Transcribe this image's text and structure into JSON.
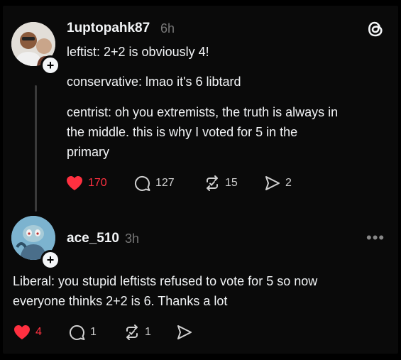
{
  "post": {
    "username": "1uptopahk87",
    "time": "6h",
    "lines": [
      "leftist: 2+2 is obviously 4!",
      "conservative: lmao it's 6 libtard",
      "centrist: oh you extremists, the truth is always in",
      "the middle. this is why I voted for 5 in the",
      "primary"
    ],
    "likes": "170",
    "comments": "127",
    "reposts": "15",
    "shares": "2"
  },
  "reply": {
    "username": "ace_510",
    "time": "3h",
    "lines": [
      "Liberal: you stupid leftists refused to vote for 5 so now",
      "everyone thinks 2+2 is 6. Thanks a lot"
    ],
    "likes": "4",
    "comments": "1",
    "reposts": "1"
  },
  "colors": {
    "like_active": "#ff3040",
    "background": "#0a0a0a",
    "muted": "#777777"
  },
  "icons": [
    "threads-logo-icon",
    "heart-icon",
    "comment-icon",
    "repost-icon",
    "share-icon",
    "more-icon",
    "follow-plus-icon"
  ]
}
